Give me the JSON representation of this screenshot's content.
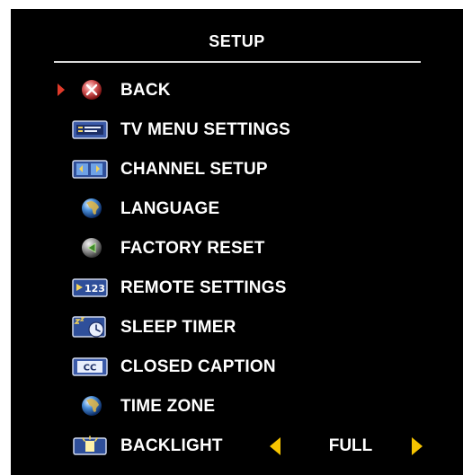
{
  "menu": {
    "title": "SETUP",
    "selected_index": 0,
    "items": [
      {
        "label": "BACK",
        "icon": "back-x-icon"
      },
      {
        "label": "TV MENU SETTINGS",
        "icon": "tv-menu-settings-icon"
      },
      {
        "label": "CHANNEL SETUP",
        "icon": "channel-setup-icon"
      },
      {
        "label": "LANGUAGE",
        "icon": "globe-icon"
      },
      {
        "label": "FACTORY RESET",
        "icon": "factory-reset-icon"
      },
      {
        "label": "REMOTE SETTINGS",
        "icon": "remote-settings-icon"
      },
      {
        "label": "SLEEP TIMER",
        "icon": "sleep-timer-icon"
      },
      {
        "label": "CLOSED CAPTION",
        "icon": "closed-caption-icon"
      },
      {
        "label": "TIME ZONE",
        "icon": "globe-icon"
      },
      {
        "label": "BACKLIGHT",
        "icon": "backlight-icon",
        "value": "FULL"
      }
    ]
  },
  "icons": {
    "cc_text": "CC",
    "remote_text": "123"
  },
  "colors": {
    "background": "#000000",
    "text": "#ffffff",
    "cursor": "#e03a2a",
    "value_arrows": "#f6c400"
  }
}
